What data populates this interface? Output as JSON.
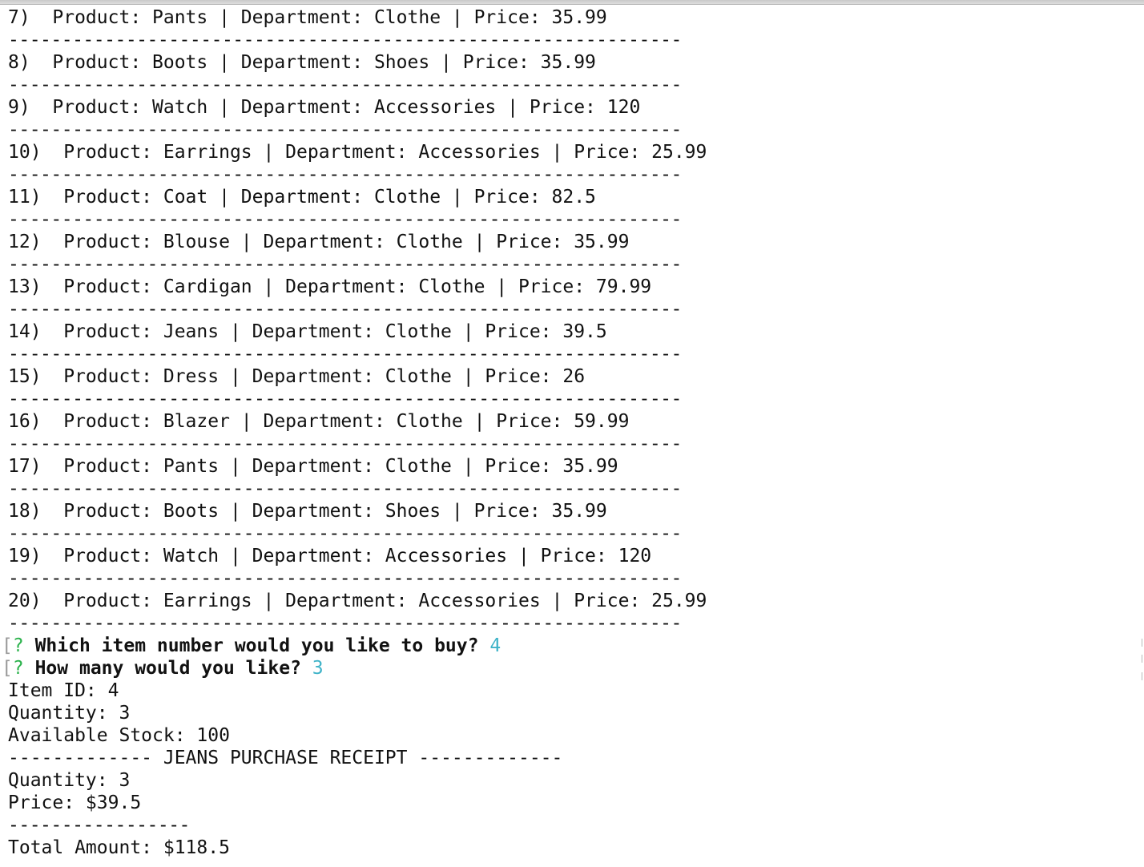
{
  "items": [
    {
      "label": "7)  Product: Pants | Department: Clothe | Price: 35.99"
    },
    {
      "label": "8)  Product: Boots | Department: Shoes | Price: 35.99"
    },
    {
      "label": "9)  Product: Watch | Department: Accessories | Price: 120"
    },
    {
      "label": "10)  Product: Earrings | Department: Accessories | Price: 25.99"
    },
    {
      "label": "11)  Product: Coat | Department: Clothe | Price: 82.5"
    },
    {
      "label": "12)  Product: Blouse | Department: Clothe | Price: 35.99"
    },
    {
      "label": "13)  Product: Cardigan | Department: Clothe | Price: 79.99"
    },
    {
      "label": "14)  Product: Jeans | Department: Clothe | Price: 39.5"
    },
    {
      "label": "15)  Product: Dress | Department: Clothe | Price: 26"
    },
    {
      "label": "16)  Product: Blazer | Department: Clothe | Price: 59.99"
    },
    {
      "label": "17)  Product: Pants | Department: Clothe | Price: 35.99"
    },
    {
      "label": "18)  Product: Boots | Department: Shoes | Price: 35.99"
    },
    {
      "label": "19)  Product: Watch | Department: Accessories | Price: 120"
    },
    {
      "label": "20)  Product: Earrings | Department: Accessories | Price: 25.99"
    }
  ],
  "separator_long": "--------------------------------------------------------------------------",
  "separator_short": "--------------------",
  "prompts": {
    "bracket": "[",
    "qmark": "?",
    "q1": "Which item number would you like to buy?",
    "a1": "4",
    "q2": "How many would you like?",
    "a2": "3"
  },
  "details": {
    "item_id": "Item ID: 4",
    "quantity": "Quantity: 3",
    "stock": "Available Stock: 100"
  },
  "receipt": {
    "header": "------------- JEANS PURCHASE RECEIPT -------------",
    "quantity": "Quantity: 3",
    "price": "Price: $39.5",
    "total": "Total Amount: $118.5"
  }
}
